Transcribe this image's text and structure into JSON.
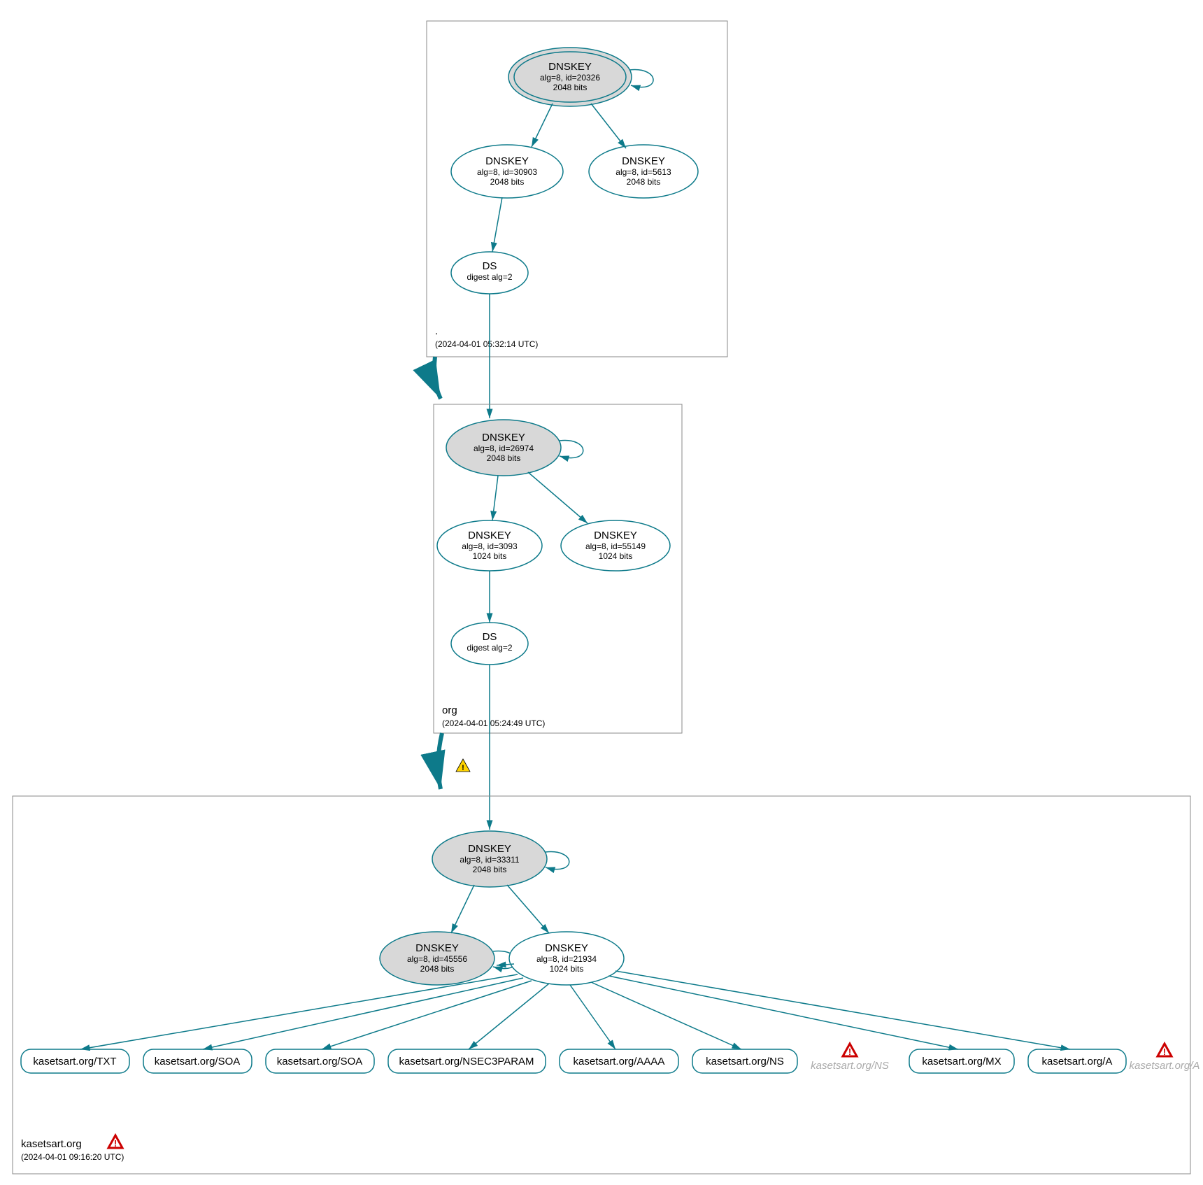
{
  "zones": {
    "root": {
      "label": ".",
      "timestamp": "(2024-04-01 05:32:14 UTC)"
    },
    "org": {
      "label": "org",
      "timestamp": "(2024-04-01 05:24:49 UTC)"
    },
    "k": {
      "label": "kasetsart.org",
      "timestamp": "(2024-04-01 09:16:20 UTC)"
    }
  },
  "nodes": {
    "root_ksk": {
      "title": "DNSKEY",
      "line2": "alg=8, id=20326",
      "line3": "2048 bits"
    },
    "root_zsk1": {
      "title": "DNSKEY",
      "line2": "alg=8, id=30903",
      "line3": "2048 bits"
    },
    "root_zsk2": {
      "title": "DNSKEY",
      "line2": "alg=8, id=5613",
      "line3": "2048 bits"
    },
    "root_ds": {
      "title": "DS",
      "line2": "digest alg=2",
      "line3": ""
    },
    "org_ksk": {
      "title": "DNSKEY",
      "line2": "alg=8, id=26974",
      "line3": "2048 bits"
    },
    "org_zsk1": {
      "title": "DNSKEY",
      "line2": "alg=8, id=3093",
      "line3": "1024 bits"
    },
    "org_zsk2": {
      "title": "DNSKEY",
      "line2": "alg=8, id=55149",
      "line3": "1024 bits"
    },
    "org_ds": {
      "title": "DS",
      "line2": "digest alg=2",
      "line3": ""
    },
    "k_ksk": {
      "title": "DNSKEY",
      "line2": "alg=8, id=33311",
      "line3": "2048 bits"
    },
    "k_zsk1": {
      "title": "DNSKEY",
      "line2": "alg=8, id=45556",
      "line3": "2048 bits"
    },
    "k_zsk2": {
      "title": "DNSKEY",
      "line2": "alg=8, id=21934",
      "line3": "1024 bits"
    }
  },
  "rrsets": {
    "txt": "kasetsart.org/TXT",
    "soa1": "kasetsart.org/SOA",
    "soa2": "kasetsart.org/SOA",
    "nsec3": "kasetsart.org/NSEC3PARAM",
    "aaaa": "kasetsart.org/AAAA",
    "ns": "kasetsart.org/NS",
    "ns_f": "kasetsart.org/NS",
    "mx": "kasetsart.org/MX",
    "a": "kasetsart.org/A",
    "a_f": "kasetsart.org/A"
  }
}
